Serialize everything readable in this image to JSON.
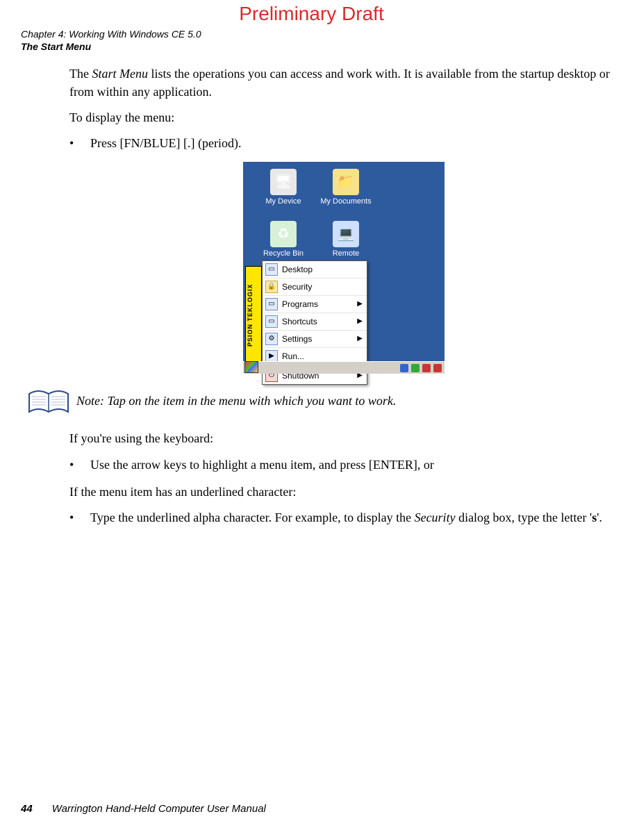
{
  "watermark": "Preliminary Draft",
  "header": {
    "chapter_line": "Chapter 4:  Working With Windows CE 5.0",
    "section_line": "The Start Menu"
  },
  "body": {
    "intro_pre": "The ",
    "intro_em": "Start Menu",
    "intro_post": " lists the operations you can access and work with. It is available from the startup desktop or from within any application.",
    "to_display": "To display the menu:",
    "bullet1": "Press [FN/BLUE] [.] (period).",
    "note_label": "Note:",
    "note_text": " Tap on the item in the menu with which you want to work.",
    "keyboard_intro": "If you're using the keyboard:",
    "bullet2": "Use the arrow keys to highlight a menu item, and press [ENTER], or",
    "underline_intro": "If the menu item has an underlined character:",
    "bullet3_pre": "Type the underlined alpha character. For example, to display the ",
    "bullet3_em": "Security",
    "bullet3_mid": " dialog box, type the letter '",
    "bullet3_bold": "s",
    "bullet3_post": "'."
  },
  "screenshot": {
    "desktop_icons": {
      "my_device": "My Device",
      "my_documents": "My Documents",
      "recycle_bin": "Recycle Bin",
      "remote_desktop": "Remote Desktop ..."
    },
    "sidebar_text": "PSION TEKLOGIX",
    "menu_items": [
      "Desktop",
      "Security",
      "Programs",
      "Shortcuts",
      "Settings",
      "Run...",
      "Shutdown"
    ],
    "submenu_arrows": [
      false,
      false,
      true,
      true,
      true,
      false,
      true
    ]
  },
  "footer": {
    "page_number": "44",
    "manual_title": "Warrington Hand-Held Computer User Manual"
  }
}
